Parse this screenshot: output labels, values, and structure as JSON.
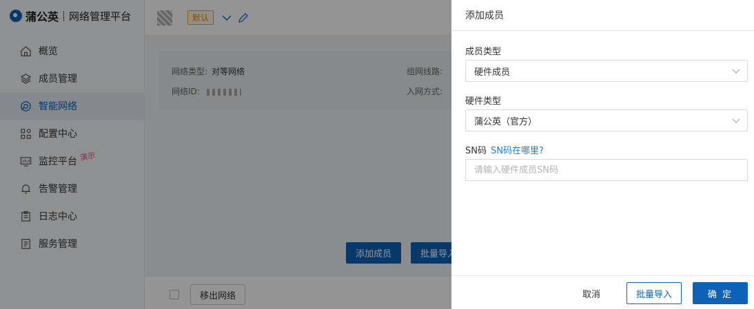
{
  "brand": {
    "name": "蒲公英",
    "subtitle": "网络管理平台"
  },
  "sidebar": {
    "items": [
      {
        "label": "概览",
        "icon": "home-icon"
      },
      {
        "label": "成员管理",
        "icon": "layers-icon"
      },
      {
        "label": "智能网络",
        "icon": "network-icon",
        "active": true
      },
      {
        "label": "配置中心",
        "icon": "grid-icon"
      },
      {
        "label": "监控平台",
        "icon": "monitor-icon",
        "badge": "演示"
      },
      {
        "label": "告警管理",
        "icon": "bell-icon"
      },
      {
        "label": "日志中心",
        "icon": "clipboard-icon"
      },
      {
        "label": "服务管理",
        "icon": "document-icon"
      }
    ]
  },
  "header": {
    "default_tag": "默认"
  },
  "network_info": {
    "type_label": "网络类型:",
    "type_value": "对等网络",
    "id_label": "网络ID:",
    "line_label": "组网线路:",
    "join_label": "入网方式:"
  },
  "main_actions": {
    "add_member": "添加成员",
    "batch_import": "批量导入"
  },
  "bottom_bar": {
    "remove_network": "移出网络"
  },
  "drawer": {
    "title": "添加成员",
    "member_type": {
      "label": "成员类型",
      "value": "硬件成员"
    },
    "hardware_type": {
      "label": "硬件类型",
      "value": "蒲公英（官方）"
    },
    "sn": {
      "label": "SN码",
      "help_link": "SN码在哪里?",
      "placeholder": "请输入硬件成员SN码",
      "value": ""
    },
    "footer": {
      "cancel": "取消",
      "batch_import": "批量导入",
      "confirm": "确 定"
    }
  },
  "colors": {
    "primary": "#0b62b7",
    "link": "#1d7cd6",
    "tag_orange": "#e08a00",
    "demo_badge": "#e84a6b"
  }
}
